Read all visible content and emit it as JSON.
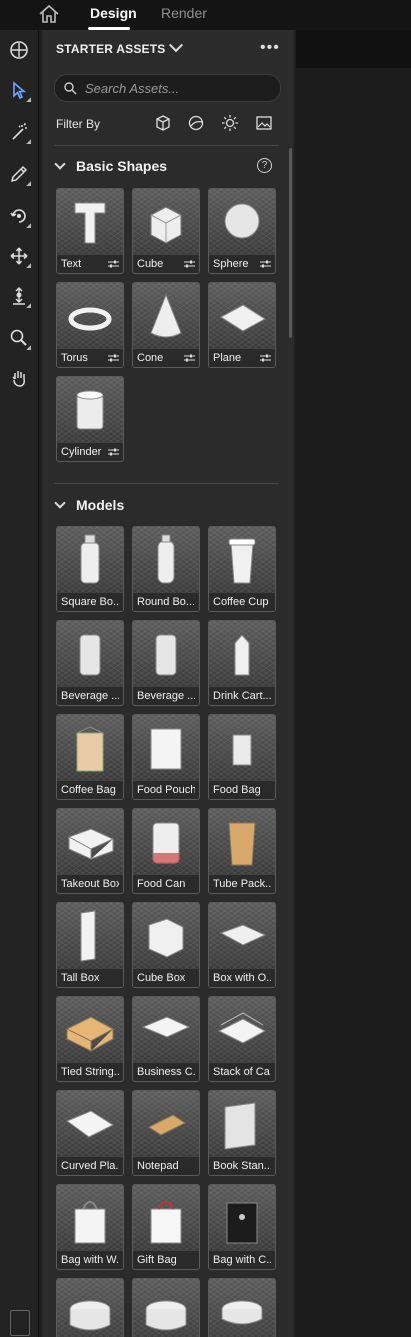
{
  "tabs": [
    {
      "label": "Design",
      "active": true
    },
    {
      "label": "Render",
      "active": false
    }
  ],
  "toolbar": {
    "tools": [
      "add-content-icon",
      "select-icon",
      "magic-wand-icon",
      "eyedropper-icon",
      "orbit-icon",
      "move-icon",
      "dolly-icon",
      "zoom-icon",
      "pan-hand-icon"
    ],
    "selected": "select-icon"
  },
  "panel": {
    "title": "STARTER ASSETS",
    "search_placeholder": "Search Assets...",
    "filter_label": "Filter By",
    "filters": [
      "3d-model-filter-icon",
      "material-filter-icon",
      "light-filter-icon",
      "image-filter-icon"
    ],
    "basic_shapes": {
      "title": "Basic Shapes",
      "items": [
        "Text",
        "Cube",
        "Sphere",
        "Torus",
        "Cone",
        "Plane",
        "Cylinder"
      ]
    },
    "models": {
      "title": "Models",
      "items": [
        "Square Bo...",
        "Round Bo...",
        "Coffee Cup",
        "Beverage ...",
        "Beverage ...",
        "Drink Cart...",
        "Coffee Bag",
        "Food Pouch",
        "Food Bag",
        "Takeout Box",
        "Food Can",
        "Tube Pack...",
        "Tall Box",
        "Cube Box",
        "Box with O...",
        "Tied String...",
        "Business C...",
        "Stack of Ca...",
        "Curved Pla...",
        "Notepad",
        "Book Stan...",
        "Bag with W...",
        "Gift Bag",
        "Bag with C...",
        "",
        "",
        ""
      ]
    }
  },
  "colors": {
    "accent": "#6aa7ff",
    "panel": "#2b2b2b",
    "tile_border": "#5b5b5b"
  }
}
